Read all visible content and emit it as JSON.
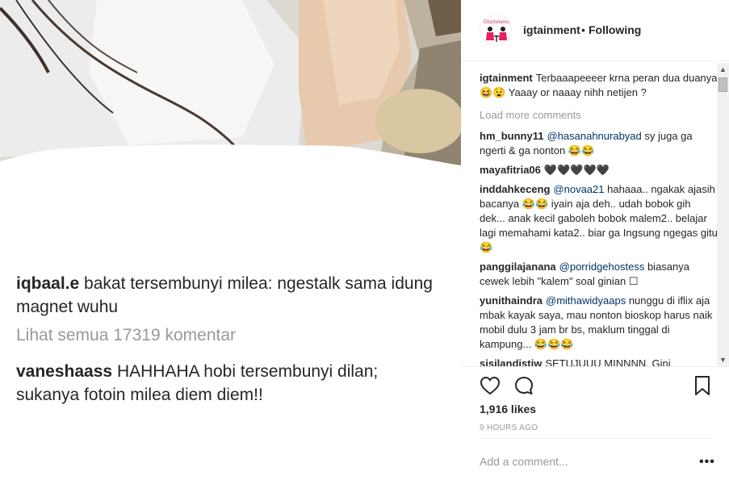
{
  "post": {
    "caption_1_user": "iqbaal.e",
    "caption_1_text": "bakat tersembunyi milea: ngestalk sama idung magnet wuhu",
    "view_all": "Lihat semua 17319 komentar",
    "caption_2_user": "vaneshaass",
    "caption_2_text": "HAHHAHA hobi tersembunyi dilan; sukanya fotoin milea diem diem!!"
  },
  "header": {
    "username": "igtainment",
    "dot": "•",
    "following": "Following",
    "avatar_text": "Gtainment"
  },
  "caption": {
    "user": "igtainment",
    "text": "Terbaaapeeeer krna peran dua duanya 😆😧 Yaaay or naaay nihh netijen ?"
  },
  "load_more": "Load more comments",
  "comments": [
    {
      "user": "hm_bunny11",
      "mention": "@hasanahnurabyad",
      "text": " sy juga ga ngerti & ga nonton 😂😂"
    },
    {
      "user": "mayafitria06",
      "mention": "",
      "text": "🖤🖤🖤🖤🖤"
    },
    {
      "user": "inddahkeceng",
      "mention": "@novaa21",
      "text": " hahaaa.. ngakak ajasih bacanya 😂😂 iyain aja deh.. udah bobok gih dek... anak kecil gaboleh bobok malem2.. belajar lagi memahami kata2.. biar ga Ingsung ngegas gitu 😂"
    },
    {
      "user": "panggilajanana",
      "mention": "@porridgehostess",
      "text": " biasanya cewek lebih \"kalem\" soal ginian ☐"
    },
    {
      "user": "yunithaindra",
      "mention": "@mithawidyaaps",
      "text": " nunggu di iflix aja mbak kayak saya, mau nonton bioskop harus naik mobil dulu 3 jam br bs, maklum tinggal di kampung... 😂😂😂"
    },
    {
      "user": "sisilandistiw",
      "mention": "",
      "text": "SETUJUUU MINNNN. Gini"
    }
  ],
  "likes": "1,916 likes",
  "time_ago": "9 HOURS AGO",
  "add_comment_placeholder": "Add a comment...",
  "more_options": "•••",
  "icons": {
    "like": "heart-outline",
    "comment": "speech-bubble-outline",
    "save": "bookmark-outline"
  },
  "colors": {
    "mention": "#003569",
    "muted": "#999999",
    "text": "#262626"
  }
}
